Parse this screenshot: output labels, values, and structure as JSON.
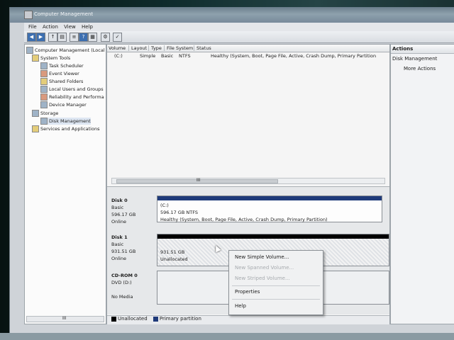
{
  "window": {
    "title": "Computer Management"
  },
  "menu": [
    "File",
    "Action",
    "View",
    "Help"
  ],
  "tree": {
    "root": "Computer Management (Local",
    "system_tools": "System Tools",
    "task_scheduler": "Task Scheduler",
    "event_viewer": "Event Viewer",
    "shared_folders": "Shared Folders",
    "local_users": "Local Users and Groups",
    "reliability": "Reliability and Performa",
    "device_manager": "Device Manager",
    "storage": "Storage",
    "disk_management": "Disk Management",
    "services": "Services and Applications"
  },
  "list": {
    "columns": [
      "Volume",
      "Layout",
      "Type",
      "File System",
      "Status"
    ],
    "row": {
      "volume": "(C:)",
      "layout": "Simple",
      "type": "Basic",
      "fs": "NTFS",
      "status": "Healthy (System, Boot, Page File, Active, Crash Dump, Primary Partition"
    },
    "hscroll_label": "III"
  },
  "disks": {
    "disk0": {
      "name": "Disk 0",
      "type": "Basic",
      "size": "596.17 GB",
      "state": "Online",
      "vol_name": "(C:)",
      "vol_size": "596.17 GB NTFS",
      "vol_status": "Healthy (System, Boot, Page File, Active, Crash Dump, Primary Partition)"
    },
    "disk1": {
      "name": "Disk 1",
      "type": "Basic",
      "size": "931.51 GB",
      "state": "Online",
      "vol_size": "931.51 GB",
      "vol_status": "Unallocated"
    },
    "cdrom": {
      "name": "CD-ROM 0",
      "type": "DVD (D:)",
      "state": "No Media"
    }
  },
  "legend": {
    "unallocated": "Unallocated",
    "primary": "Primary partition"
  },
  "actions": {
    "header": "Actions",
    "section": "Disk Management",
    "more": "More Actions"
  },
  "context_menu": {
    "new_simple": "New Simple Volume...",
    "new_spanned": "New Spanned Volume...",
    "new_striped": "New Striped Volume...",
    "properties": "Properties",
    "help": "Help"
  },
  "tree_hscroll_label": "III",
  "colors": {
    "primary_partition": "#1f3a7a",
    "unallocated": "#000000"
  }
}
